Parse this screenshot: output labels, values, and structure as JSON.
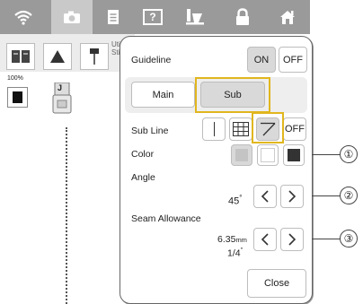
{
  "topbar": {
    "icons": [
      "wifi-icon",
      "camera-icon",
      "document-icon",
      "help-icon",
      "thread-icon",
      "lock-icon",
      "home-icon"
    ],
    "help_glyph": "?"
  },
  "row2": {
    "label_line1": "Util",
    "label_line2": "Stit"
  },
  "leftpane": {
    "zoom": "100%",
    "foot_letter": "J"
  },
  "panel": {
    "guideline": {
      "label": "Guideline",
      "on": "ON",
      "off": "OFF"
    },
    "tabs": {
      "main": "Main",
      "sub": "Sub"
    },
    "subline": {
      "label": "Sub Line",
      "off": "OFF"
    },
    "color": {
      "label": "Color"
    },
    "angle": {
      "label": "Angle",
      "value": "45",
      "unit": "°"
    },
    "seam": {
      "label": "Seam Allowance",
      "value_mm": "6.35",
      "unit_mm": "mm",
      "value_in": "1/4",
      "unit_in": "\""
    },
    "close": "Close"
  },
  "callouts": [
    "①",
    "②",
    "③"
  ],
  "colors": {
    "highlight": "#e1b61e",
    "topbar": "#9a9a9a"
  }
}
